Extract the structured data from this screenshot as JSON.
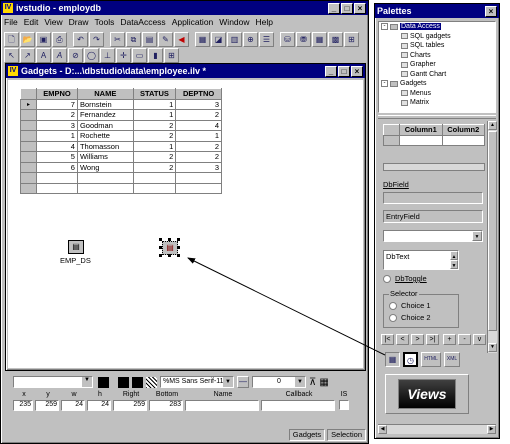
{
  "main": {
    "title": "ivstudio - employdb",
    "logo": "IV",
    "menu": [
      "File",
      "Edit",
      "View",
      "Draw",
      "Tools",
      "DataAccess",
      "Application",
      "Window",
      "Help"
    ],
    "toolbar1": [
      "new-icon",
      "open-icon",
      "save-icon",
      "print-icon",
      "undo-icon",
      "redo-icon",
      "cut-icon",
      "copy-icon",
      "paste-icon",
      "edit-icon",
      "stop-icon",
      "gadget-icon",
      "grapher-icon",
      "chart-icon",
      "zoom-icon",
      "list-icon",
      "db-icon",
      "db2-icon",
      "table-icon",
      "layout-icon",
      "sql-icon"
    ],
    "toolbar2": [
      "select-icon",
      "arrow-icon",
      "text-icon",
      "font-icon",
      "link-icon",
      "ellipse-icon",
      "pin-icon",
      "crosshair-icon",
      "rect-icon",
      "bars-icon",
      "grid-icon"
    ]
  },
  "gadgets_window": {
    "title": "Gadgets - D:...\\dbstudio\\data\\employee.ilv *",
    "table": {
      "headers": [
        "EMPNO",
        "NAME",
        "STATUS",
        "DEPTNO"
      ],
      "current_indicator": "▸",
      "rows": [
        [
          "7",
          "Bornstein",
          "1",
          "3"
        ],
        [
          "2",
          "Fernandez",
          "1",
          "2"
        ],
        [
          "3",
          "Goodman",
          "2",
          "4"
        ],
        [
          "1",
          "Rochette",
          "2",
          "1"
        ],
        [
          "4",
          "Thomasson",
          "1",
          "2"
        ],
        [
          "5",
          "Williams",
          "2",
          "2"
        ],
        [
          "6",
          "Wong",
          "2",
          "3"
        ]
      ]
    },
    "emp_ds_label": "EMP_DS"
  },
  "bottom": {
    "font_value": "%MS Sans Serif-11",
    "line_value": "0",
    "headers": [
      "x",
      "y",
      "w",
      "h",
      "Right",
      "Bottom",
      "Name",
      "Callback",
      "IS"
    ],
    "values": [
      "235",
      "259",
      "24",
      "24",
      "259",
      "283",
      "",
      "",
      ""
    ],
    "status": [
      "Gadgets",
      "Selection"
    ]
  },
  "palettes": {
    "title": "Palettes",
    "tree": [
      {
        "label": "Data Access",
        "level": 0,
        "selected": true
      },
      {
        "label": "SQL gadgets",
        "level": 1
      },
      {
        "label": "SQL tables",
        "level": 1
      },
      {
        "label": "Charts",
        "level": 1
      },
      {
        "label": "Grapher",
        "level": 1
      },
      {
        "label": "Gantt Chart",
        "level": 1
      },
      {
        "label": "Gadgets",
        "level": 0
      },
      {
        "label": "Menus",
        "level": 1
      },
      {
        "label": "Matrix",
        "level": 1
      }
    ],
    "table_cols": [
      "Column1",
      "Column2"
    ],
    "dbfield": "DbField",
    "entryfield": "EntryField",
    "dbtext": "DbText",
    "dbtoggle": "DbToggle",
    "selector": "Selector",
    "choices": [
      "Choice 1",
      "Choice 2"
    ],
    "nav_buttons": [
      "|<",
      "<",
      ">",
      ">|",
      "+",
      "-",
      "v"
    ],
    "bottom_icons": [
      "grid-icon",
      "clock-icon",
      "html-icon",
      "xml-icon"
    ],
    "views_logo": "Views"
  }
}
